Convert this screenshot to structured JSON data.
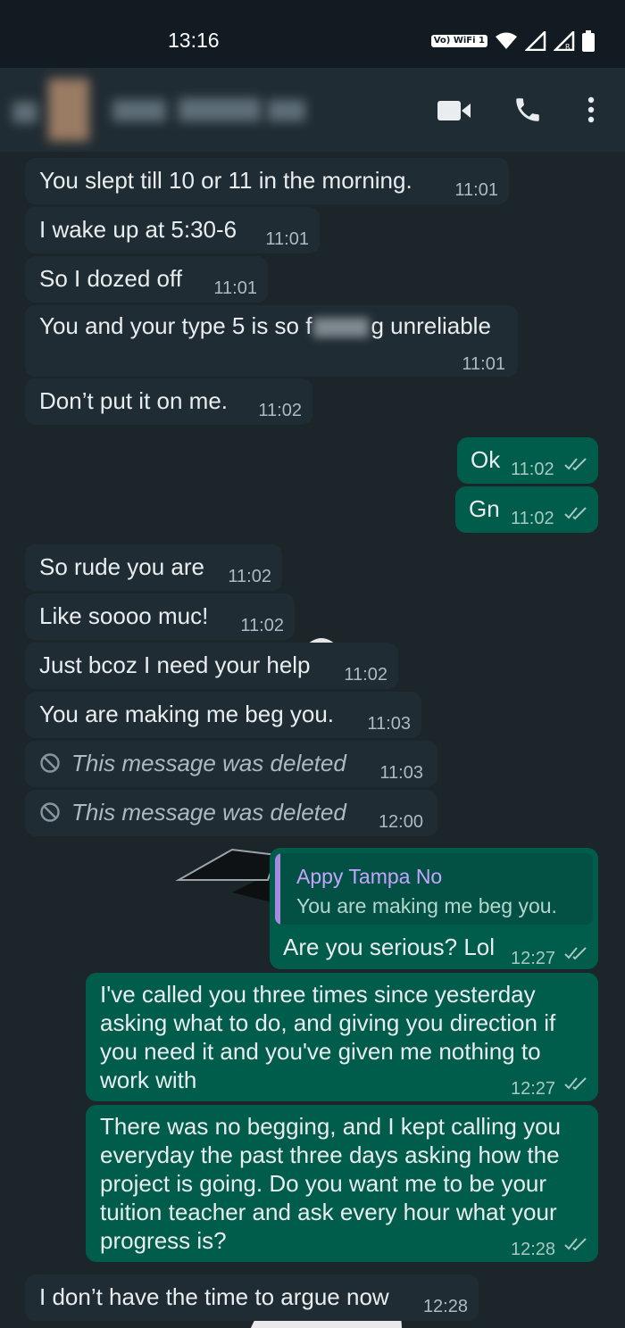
{
  "status_bar": {
    "time": "13:16",
    "volte": "Vo) WiFi 1"
  },
  "header": {
    "contact_name": "",
    "video_call_icon": "video-camera-icon",
    "voice_call_icon": "phone-icon",
    "menu_icon": "more-vertical-icon"
  },
  "messages": [
    {
      "dir": "in",
      "text": "You slept till 10 or 11 in the morning.",
      "time": "11:01"
    },
    {
      "dir": "in",
      "text": "I wake up at 5:30-6",
      "time": "11:01"
    },
    {
      "dir": "in",
      "text": "So I dozed off",
      "time": "11:01"
    },
    {
      "dir": "in",
      "text_before": "You and your type 5 is so f",
      "text_after": "g unreliable",
      "time": "11:01"
    },
    {
      "dir": "in",
      "text": "Don’t put it on me.",
      "time": "11:02"
    },
    {
      "dir": "out",
      "text": "Ok",
      "time": "11:02"
    },
    {
      "dir": "out",
      "text": "Gn",
      "time": "11:02"
    },
    {
      "dir": "in",
      "text": "So rude you are",
      "time": "11:02"
    },
    {
      "dir": "in",
      "text": "Like soooo muc!",
      "time": "11:02"
    },
    {
      "dir": "in",
      "text": "Just bcoz I need your help",
      "time": "11:02"
    },
    {
      "dir": "in",
      "text": "You are making me beg you.",
      "time": "11:03"
    },
    {
      "dir": "in",
      "text": "This message was deleted",
      "time": "11:03",
      "deleted": true
    },
    {
      "dir": "in",
      "text": "This message was deleted",
      "time": "12:00",
      "deleted": true
    },
    {
      "dir": "out",
      "quote_name": "Appy Tampa No",
      "quote_text": "You are making me beg you.",
      "text": "Are you serious? Lol",
      "time": "12:27"
    },
    {
      "dir": "out",
      "lines": [
        "I've called you three times since yesterday",
        "asking what to do, and giving you direction if",
        "you need it and you've given me nothing to",
        "work with"
      ],
      "time": "12:27"
    },
    {
      "dir": "out",
      "lines": [
        "There was no begging, and I kept calling you",
        "everyday the past three days asking how the",
        "project is going. Do you want me to be your",
        "tuition teacher and ask every hour what your",
        "progress is?"
      ],
      "time": "12:28"
    },
    {
      "dir": "in",
      "text": "I don’t have the time to argue now",
      "time": "12:28"
    }
  ],
  "colors": {
    "incoming_bubble": "#202c33",
    "outgoing_bubble": "#005c4b",
    "read_ticks": "#a8c9c1"
  }
}
